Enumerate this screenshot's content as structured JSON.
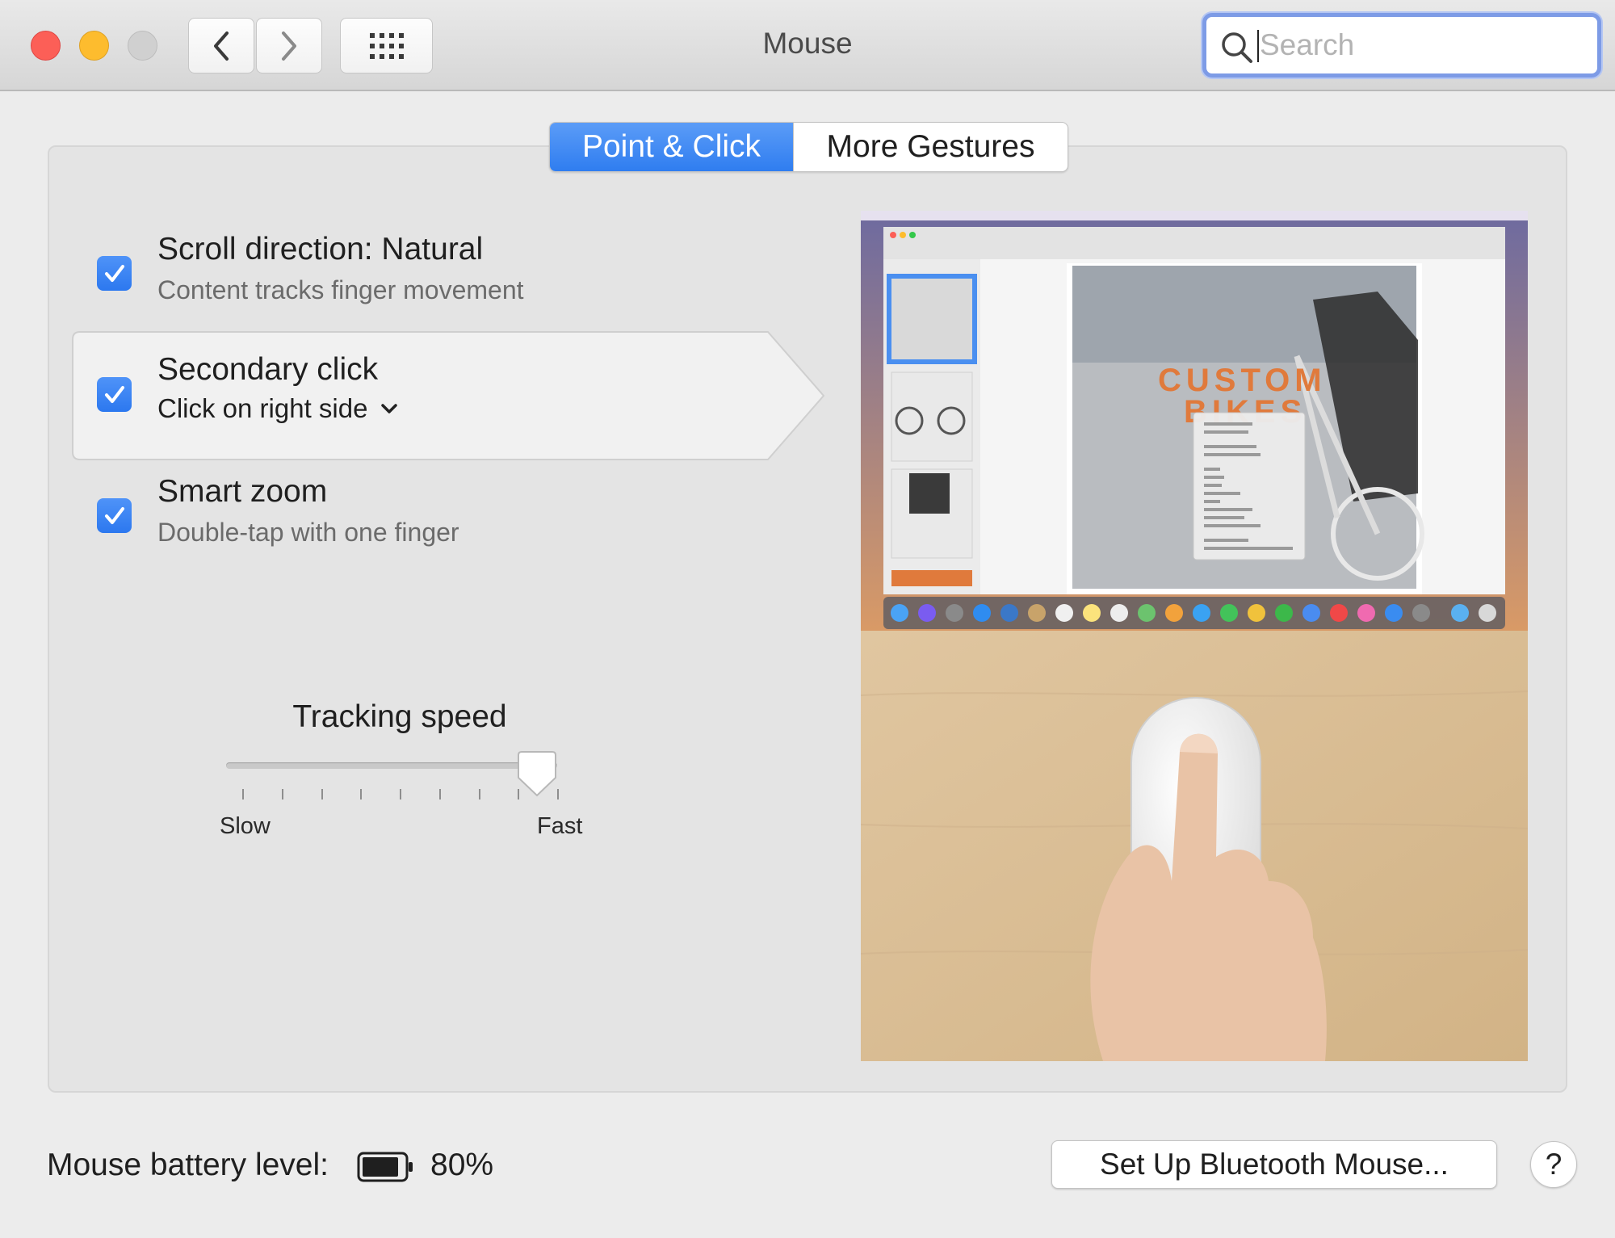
{
  "window": {
    "title": "Mouse"
  },
  "search": {
    "placeholder": "Search"
  },
  "tabs": [
    {
      "label": "Point & Click",
      "selected": true
    },
    {
      "label": "More Gestures",
      "selected": false
    }
  ],
  "options": [
    {
      "title": "Scroll direction: Natural",
      "subtitle": "Content tracks finger movement",
      "checked": true
    },
    {
      "title": "Secondary click",
      "subtitle": "Click on right side",
      "checked": true,
      "has_popup": true
    },
    {
      "title": "Smart zoom",
      "subtitle": "Double-tap with one finger",
      "checked": true
    }
  ],
  "tracking": {
    "label": "Tracking speed",
    "min_label": "Slow",
    "max_label": "Fast",
    "value_fraction": 0.94,
    "ticks": 9
  },
  "preview": {
    "screen_text": "CUSTOM BIKES"
  },
  "footer": {
    "battery_label": "Mouse battery level:",
    "battery_percent": "80%",
    "bluetooth_button": "Set Up Bluetooth Mouse...",
    "help_label": "?"
  },
  "colors": {
    "accent": "#2f7df0",
    "close": "#fc5f57",
    "minimize": "#fdbc2e",
    "zoom_disabled": "#d0d0d0",
    "focus_ring": "#7d9be6"
  }
}
